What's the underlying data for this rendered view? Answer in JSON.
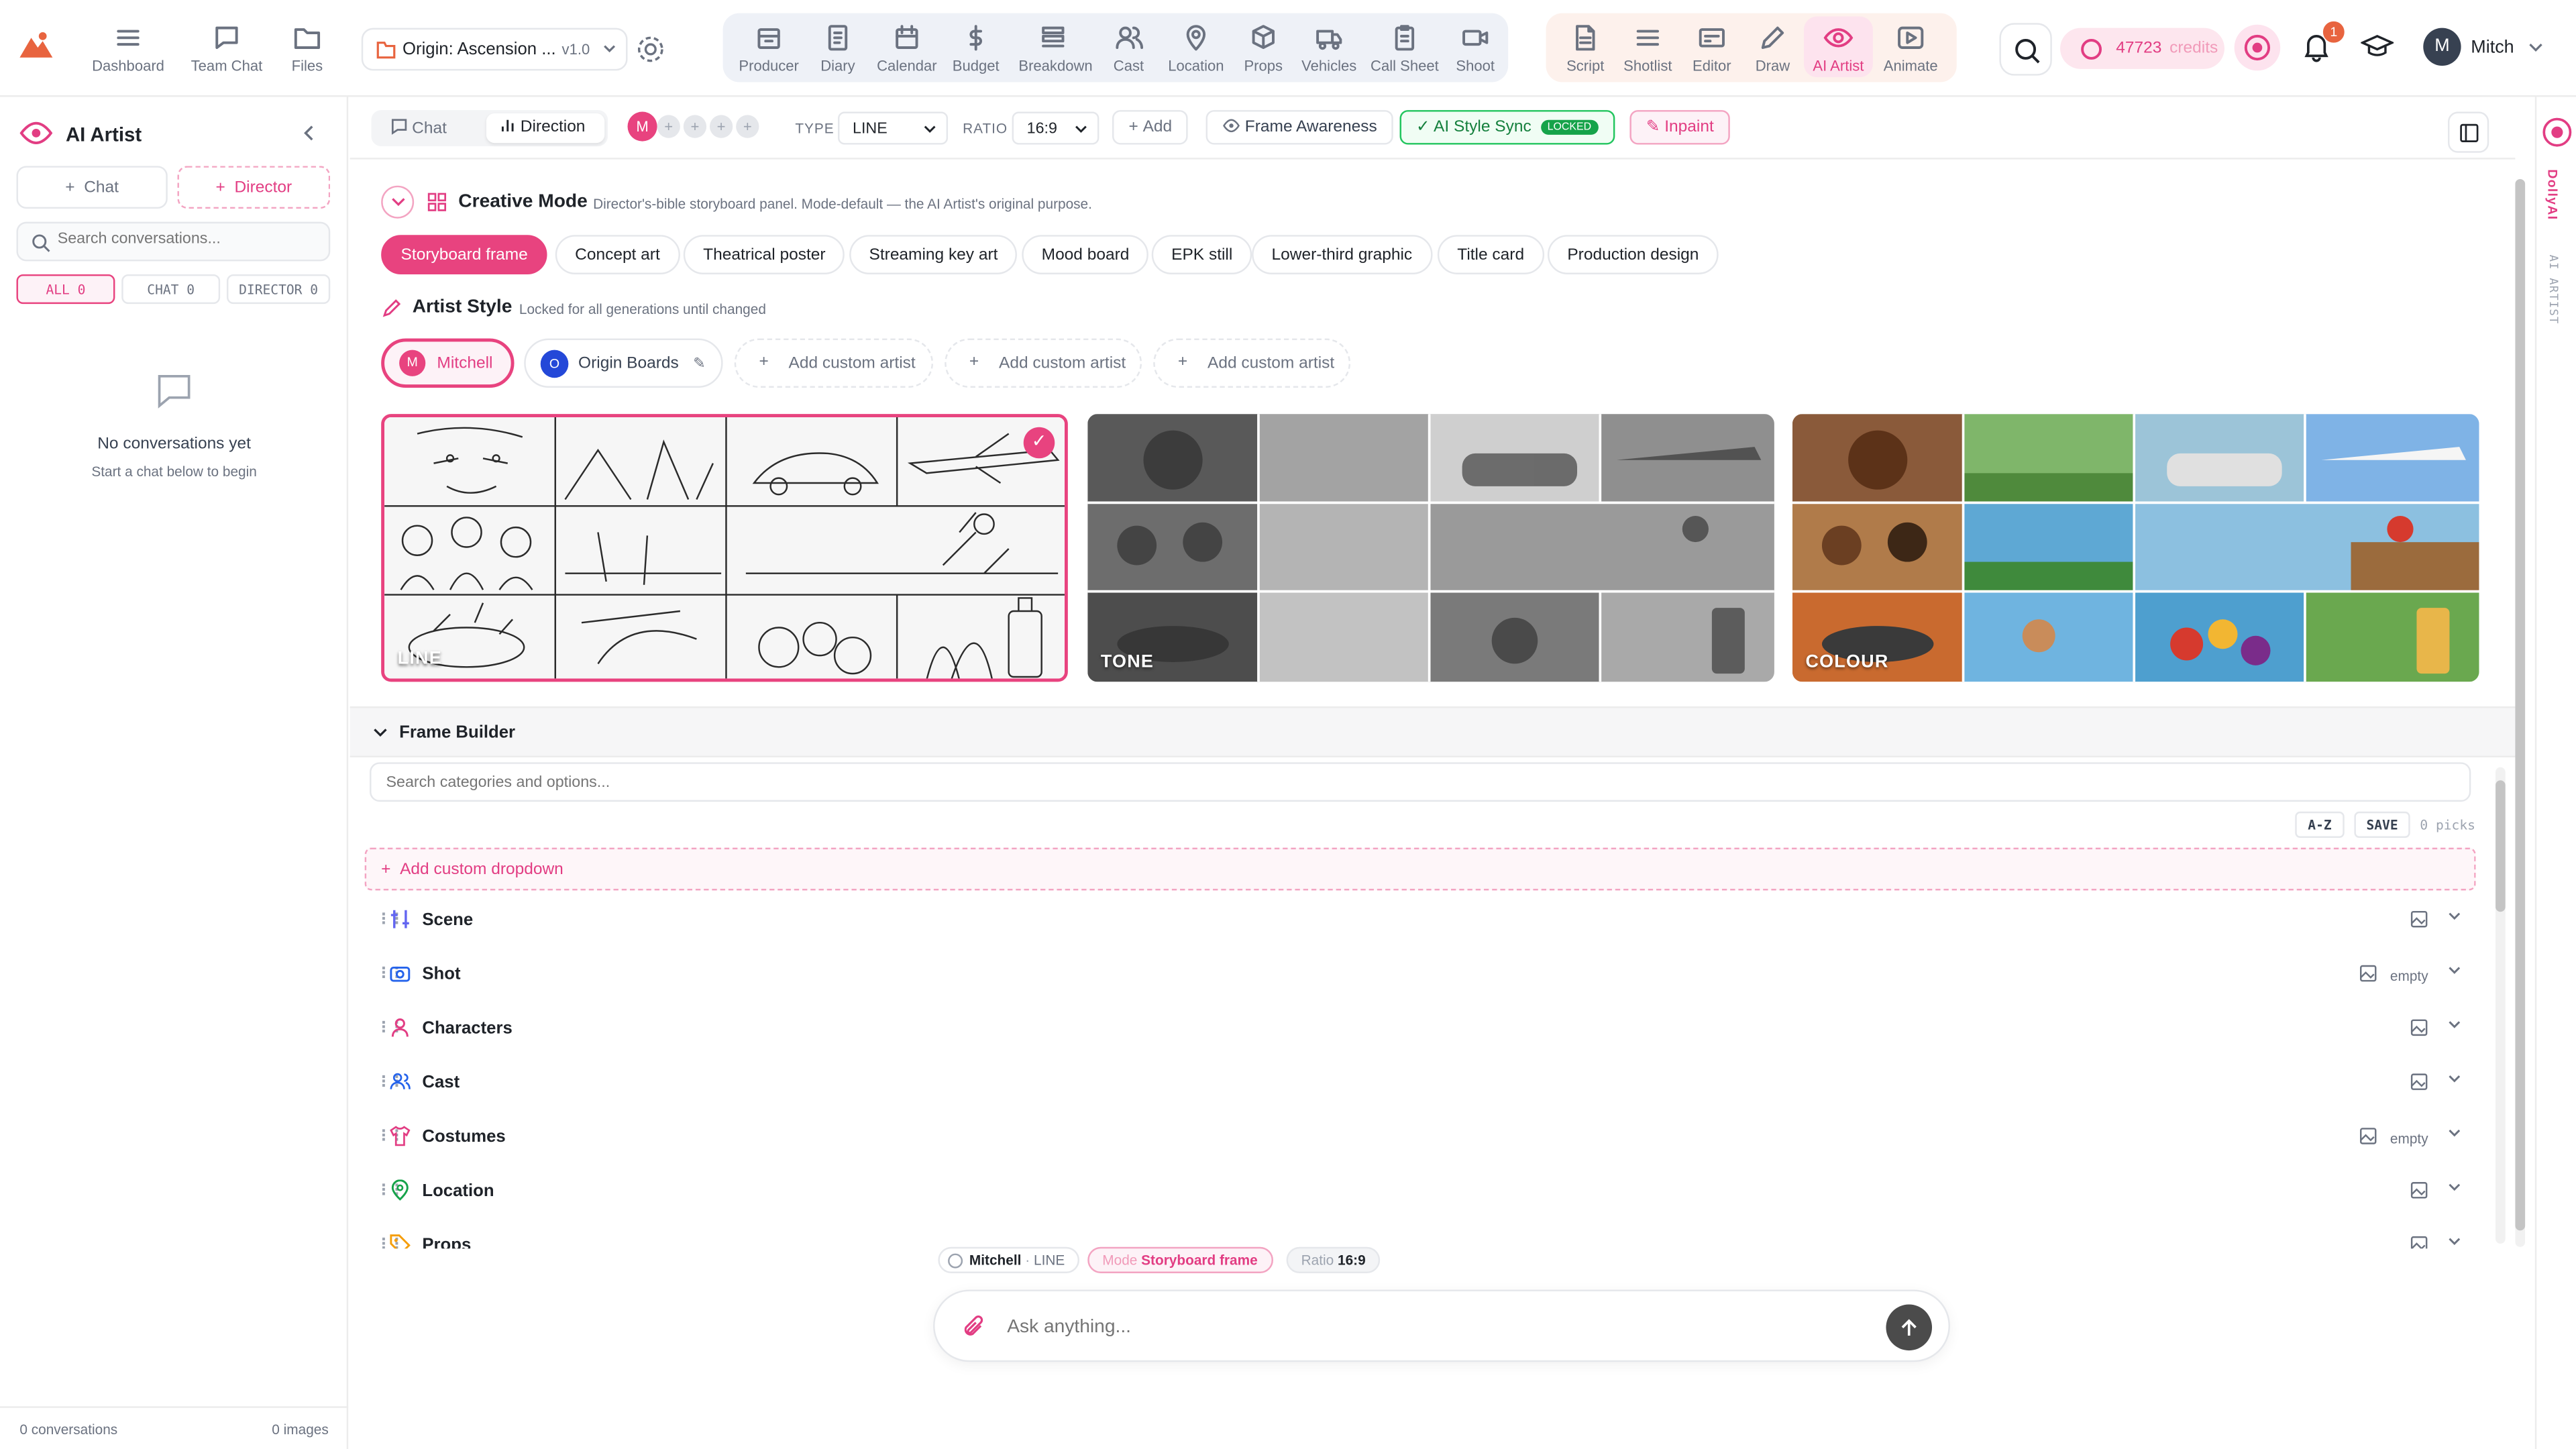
{
  "topbar": {
    "nav": [
      {
        "label": "Dashboard",
        "icon": "dashboard-icon"
      },
      {
        "label": "Team Chat",
        "icon": "chat-bubble-icon"
      },
      {
        "label": "Files",
        "icon": "folder-icon"
      }
    ],
    "project": {
      "name": "Origin: Ascension ...",
      "version": "v1.0"
    },
    "production_tools": [
      {
        "label": "Producer",
        "icon": "producer-icon"
      },
      {
        "label": "Diary",
        "icon": "diary-icon"
      },
      {
        "label": "Calendar",
        "icon": "calendar-icon"
      },
      {
        "label": "Budget",
        "icon": "dollar-icon"
      },
      {
        "label": "Breakdown",
        "icon": "breakdown-icon"
      },
      {
        "label": "Cast",
        "icon": "cast-icon"
      },
      {
        "label": "Location",
        "icon": "location-pin-icon"
      },
      {
        "label": "Props",
        "icon": "cube-icon"
      },
      {
        "label": "Vehicles",
        "icon": "truck-icon"
      },
      {
        "label": "Call Sheet",
        "icon": "clipboard-icon"
      },
      {
        "label": "Shoot",
        "icon": "camera-icon"
      }
    ],
    "post_tools": [
      {
        "label": "Script",
        "icon": "script-icon"
      },
      {
        "label": "Shotlist",
        "icon": "list-icon"
      },
      {
        "label": "Editor",
        "icon": "editor-icon"
      },
      {
        "label": "Draw",
        "icon": "pencil-icon"
      },
      {
        "label": "AI Artist",
        "icon": "eye-icon",
        "active": true
      },
      {
        "label": "Animate",
        "icon": "play-icon"
      }
    ],
    "credits": "47723",
    "credits_unit": "credits",
    "notifications": "1",
    "user_initial": "M",
    "user_name": "Mitch",
    "accent": "#e8437f"
  },
  "sidebar": {
    "title": "AI Artist",
    "chat_button": "Chat",
    "director_button": "Director",
    "search_placeholder": "Search conversations...",
    "tabs": [
      "ALL 0",
      "CHAT 0",
      "DIRECTOR 0"
    ],
    "empty_title": "No conversations yet",
    "empty_subtitle": "Start a chat below to begin",
    "footer_left": "0 conversations",
    "footer_right": "0 images"
  },
  "toolbar": {
    "chat_tab": "Chat",
    "direction_tab": "Direction",
    "avatar_initial": "M",
    "type_label": "TYPE",
    "type_value": "LINE",
    "ratio_label": "RATIO",
    "ratio_value": "16:9",
    "add_button": "Add",
    "frame_awareness": "Frame Awareness",
    "style_sync": "AI Style Sync",
    "style_sync_badge": "LOCKED",
    "inpaint": "Inpaint"
  },
  "creative_mode": {
    "title": "Creative Mode",
    "description": "Director's-bible storyboard panel. Mode-default — the AI Artist's original purpose.",
    "modes": [
      "Storyboard frame",
      "Concept art",
      "Theatrical poster",
      "Streaming key art",
      "Mood board",
      "EPK still",
      "Lower-third graphic",
      "Title card",
      "Production design"
    ],
    "selected": "Storyboard frame"
  },
  "artist_style": {
    "title": "Artist Style",
    "subtitle": "Locked for all generations until changed",
    "artists": [
      {
        "initial": "M",
        "name": "Mitchell",
        "selected": true
      },
      {
        "initial": "O",
        "name": "Origin Boards",
        "selected": false
      }
    ],
    "add_custom": "Add custom artist",
    "styles": [
      {
        "label": "LINE",
        "selected": true
      },
      {
        "label": "TONE",
        "selected": false
      },
      {
        "label": "COLOUR",
        "selected": false
      }
    ]
  },
  "frame_builder": {
    "title": "Frame Builder",
    "search_placeholder": "Search categories and options...",
    "sort_button": "A-Z",
    "save_button": "SAVE",
    "picks": "0 picks",
    "add_custom": "Add custom dropdown",
    "categories": [
      {
        "name": "Scene",
        "icon": "scene-icon",
        "status": ""
      },
      {
        "name": "Shot",
        "icon": "camera-icon",
        "status": "empty"
      },
      {
        "name": "Characters",
        "icon": "person-icon",
        "status": ""
      },
      {
        "name": "Cast",
        "icon": "people-icon",
        "status": ""
      },
      {
        "name": "Costumes",
        "icon": "shirt-icon",
        "status": "empty"
      },
      {
        "name": "Location",
        "icon": "location-pin-icon",
        "status": ""
      },
      {
        "name": "Props",
        "icon": "tag-icon",
        "status": ""
      }
    ]
  },
  "prompt_bar": {
    "artist": "Mitchell",
    "artist_style": "LINE",
    "mode_label": "Mode",
    "mode_value": "Storyboard frame",
    "ratio_label": "Ratio",
    "ratio_value": "16:9",
    "placeholder": "Ask anything..."
  },
  "right_rail": {
    "brand": "DollyAI",
    "section": "AI ARTIST"
  }
}
